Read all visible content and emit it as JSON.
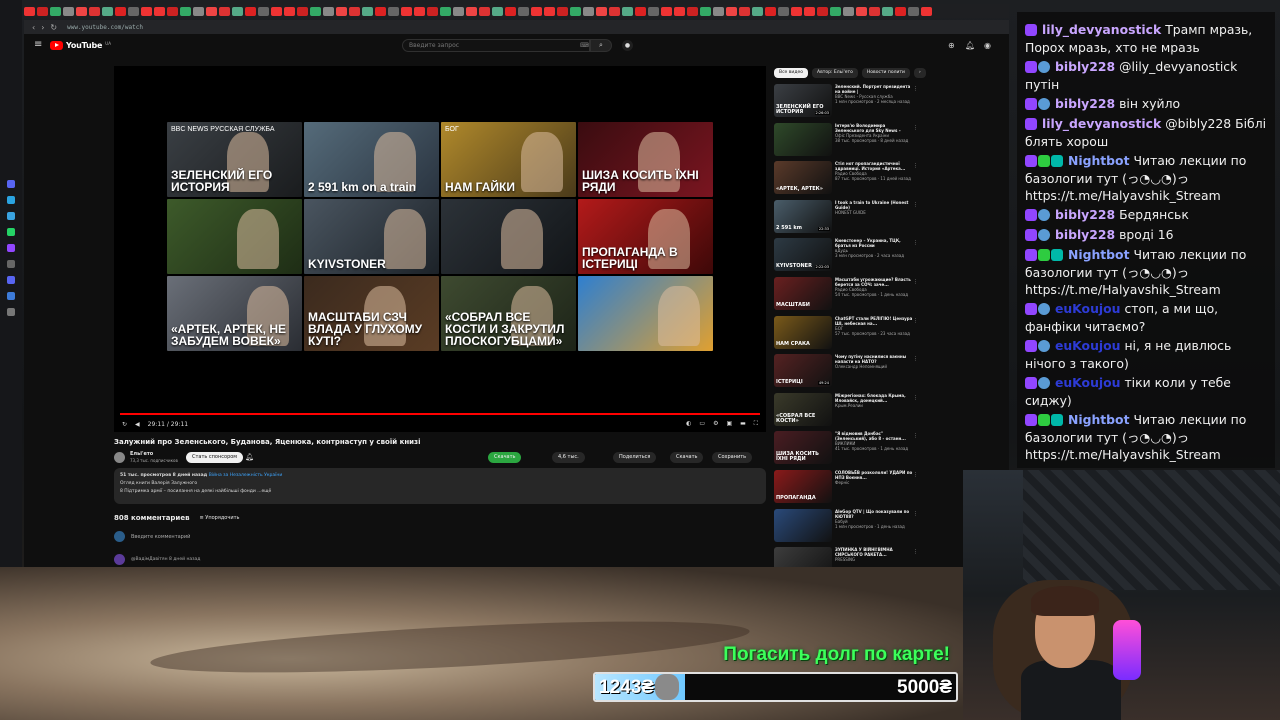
{
  "browser": {
    "url": "www.youtube.com/watch"
  },
  "youtube": {
    "logo_text": "YouTube",
    "logo_region": "UA",
    "search_placeholder": "Введите запрос",
    "video": {
      "title": "Залужний про Зеленського, Буданова, Яценюка, контрнаступ у своїй книзі",
      "time": "29:11 / 29:11",
      "progress": 1.0,
      "thumbnails": [
        {
          "caption": "ЗЕЛЕНСКИЙ ЕГО ИСТОРИЯ",
          "sub": "BBC NEWS РУССКАЯ СЛУЖБА"
        },
        {
          "caption": "2 591 km on a train",
          "sub": ""
        },
        {
          "caption": "НАМ ГАЙКИ",
          "sub": "БОГ"
        },
        {
          "caption": "ШИЗА КОСИТЬ ЇХНІ РЯДИ",
          "sub": ""
        },
        {
          "caption": "",
          "sub": ""
        },
        {
          "caption": "KYIVSTONER",
          "sub": ""
        },
        {
          "caption": "",
          "sub": ""
        },
        {
          "caption": "ПРОПАГАНДА В ІСТЕРИЦІ",
          "sub": ""
        },
        {
          "caption": "«АРТЕК, АРТЕК, НЕ ЗАБУДЕМ ВОВЕК»",
          "sub": ""
        },
        {
          "caption": "МАСШТАБИ СЗЧ ВЛАДА У ГЛУХОМУ КУТІ?",
          "sub": ""
        },
        {
          "caption": "«СОБРАЛ ВСЕ КОСТИ И ЗАКРУТИЛ ПЛОСКОГУБЦАМИ»",
          "sub": ""
        },
        {
          "caption": "",
          "sub": ""
        }
      ]
    },
    "channel": {
      "name": "Ельі'ето",
      "subs": "73,3 тыс. подписчиков",
      "sponsor_label": "Стать спонсором",
      "download_label": "Скачать",
      "likes": "4,6 тыс.",
      "share_label": "Поделиться",
      "save_label": "Сохранить",
      "download2_label": "Скачать"
    },
    "description": {
      "views": "51 тыс. просмотров  8 дней назад",
      "line1": "Війна за Незалежність України",
      "line2": "Огляд книги Валерія Залужного",
      "line3": "8 Підтримка армії – посилання на деякі найбільші фонди  ...ещё"
    },
    "comments": {
      "count_label": "808 комментариев",
      "sort_label": "Упорядочить",
      "add_placeholder": "Введите комментарий",
      "first_author": "@ВадімДавітян 8 дней назад"
    },
    "chips": [
      "Все видео",
      "Автор: Ельі'ето",
      "Новости полити"
    ],
    "recommendations": [
      {
        "title": "Зеленский. Портрет президента на войне |",
        "channel": "BBC News - Русская служба",
        "meta": "1 млн просмотров · 2 месяца назад",
        "duration": "2:26:03",
        "cap": "ЗЕЛЕНСКИЙ ЕГО ИСТОРИЯ"
      },
      {
        "title": "Інтерв'ю Володимира Зеленського для Sky News –",
        "channel": "Офіс Президента України",
        "meta": "38 тыс. просмотров · 8 дней назад",
        "duration": "",
        "cap": ""
      },
      {
        "title": "Стіл нот пропагандистичної здравниці. История «Артека...",
        "channel": "Радио Свобода",
        "meta": "87 тыс. просмотров · 11 дней назад",
        "duration": "",
        "cap": "«АРТЕК, АРТЕК»"
      },
      {
        "title": "I took a train to Ukraine (Honest Guide)",
        "channel": "HONEST GUIDE",
        "meta": "",
        "duration": "22:33",
        "cap": "2 591 km"
      },
      {
        "title": "Киевстонер – Украина, ТЦК, братья из России",
        "channel": "вДудь",
        "meta": "3 млн просмотров · 2 часа назад",
        "duration": "2:22:03",
        "cap": "KYIVSTONER"
      },
      {
        "title": "Масштаби угрожающие? Власть берется за СОЧ: зачe...",
        "channel": "Радио Свобода",
        "meta": "54 тыс. просмотров · 1 день назад",
        "duration": "",
        "cap": "МАСШТАБИ"
      },
      {
        "title": "ChatGPT стали РЕЛІГІЮ! Цензура ШІ, небесная на...",
        "channel": "БОГ",
        "meta": "57 тыс. просмотров · 23 часа назад",
        "duration": "",
        "cap": "НАМ СРАКА"
      },
      {
        "title": "Чому путіну наснилися ваєнны напасти на НАТО?",
        "channel": "Олександр Непомнящий",
        "meta": "",
        "duration": "49:24",
        "cap": "ІСТЕРИЦІ"
      },
      {
        "title": "Міжрегіонах: блокада Крыма, Иловайск, донецкий...",
        "channel": "Крым.Реалии",
        "meta": "",
        "duration": "",
        "cap": "«СОБРАЛ ВСЕ КОСТИ»"
      },
      {
        "title": "\"Я відмовив Донбас\" (Зеленський), або 8 - останн...",
        "channel": "ВИКЛИКИ",
        "meta": "41 тыс. просмотров · 1 день назад",
        "duration": "",
        "cap": "ШИЗА КОСИТЬ ЇХНІ РЯДИ"
      },
      {
        "title": "СОЛОВЬЁВ розкололи! УДАРИ по НПЗ Воєння...",
        "channel": "Ферніс",
        "meta": "",
        "duration": "",
        "cap": "ПРОПАГАНДА"
      },
      {
        "title": "AleGop QTV | Що показували по КЮТ88?",
        "channel": "Бабуй",
        "meta": "1 млн просмотров · 1 день назад",
        "duration": "",
        "cap": ""
      },
      {
        "title": "ЗУПИНКА У ВІЙНІ!ВІМНА СИРСЬКОГО РАКЕТА...",
        "channel": "PRESSING",
        "meta": "",
        "duration": "",
        "cap": ""
      }
    ]
  },
  "chat": [
    {
      "badges": [
        "b-purple"
      ],
      "user": "lily_devyanostick",
      "color": "#c9a6ff",
      "text": "Трамп мразь, Порох мразь, хто не мразь"
    },
    {
      "badges": [
        "b-purple",
        "b-blue"
      ],
      "user": "bibly228",
      "color": "#c9a6ff",
      "text": "@lily_devyanostick путін"
    },
    {
      "badges": [
        "b-purple",
        "b-blue"
      ],
      "user": "bibly228",
      "color": "#c9a6ff",
      "text": "він хуйло"
    },
    {
      "badges": [
        "b-purple"
      ],
      "user": "lily_devyanostick",
      "color": "#c9a6ff",
      "text": "@bibly228 Біблі блять хорош"
    },
    {
      "badges": [
        "b-purple",
        "b-green",
        "b-teal"
      ],
      "user": "Nightbot",
      "color": "#8aa2ff",
      "text": "Читаю лекции по базологии тут (っ◔◡◔)っ https://t.me/Halyavshik_Stream"
    },
    {
      "badges": [
        "b-purple",
        "b-blue"
      ],
      "user": "bibly228",
      "color": "#c9a6ff",
      "text": "Бердянськ"
    },
    {
      "badges": [
        "b-purple",
        "b-blue"
      ],
      "user": "bibly228",
      "color": "#c9a6ff",
      "text": "вроді 16"
    },
    {
      "badges": [
        "b-purple",
        "b-green",
        "b-teal"
      ],
      "user": "Nightbot",
      "color": "#8aa2ff",
      "text": "Читаю лекции по базологии тут (っ◔◡◔)っ https://t.me/Halyavshik_Stream"
    },
    {
      "badges": [
        "b-purple",
        "b-blue"
      ],
      "user": "euKoujou",
      "color": "#2d3bd6",
      "text": "стоп, а ми що, фанфіки читаємо?"
    },
    {
      "badges": [
        "b-purple",
        "b-blue"
      ],
      "user": "euKoujou",
      "color": "#2d3bd6",
      "text": "ні, я не дивлюсь нічого з такого)"
    },
    {
      "badges": [
        "b-purple",
        "b-blue"
      ],
      "user": "euKoujou",
      "color": "#2d3bd6",
      "text": "тіки коли у тебе сиджу)"
    },
    {
      "badges": [
        "b-purple",
        "b-green",
        "b-teal"
      ],
      "user": "Nightbot",
      "color": "#8aa2ff",
      "text": "Читаю лекции по базологии тут (っ◔◡◔)っ https://t.me/Halyavshik_Stream"
    }
  ],
  "goal": {
    "title": "Погасить долг по карте!",
    "current": "1243₴",
    "target": "5000₴",
    "fraction": 0.2486
  }
}
